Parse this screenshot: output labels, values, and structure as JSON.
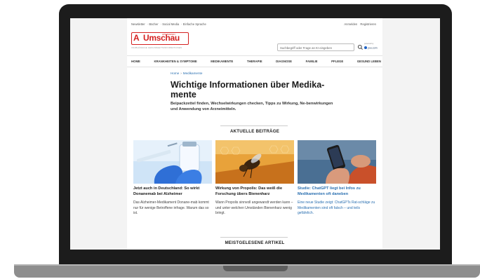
{
  "utility_left": [
    "Newsletter",
    "Bücher",
    "Social Media",
    "Einfache Sprache"
  ],
  "utility_right": [
    "Anmelden",
    "Registrieren"
  ],
  "logo": {
    "mark": "A",
    "word": "Umschau",
    "small": "APOTHEKEN",
    "tagline": "UNABHÄNGIGE GESUNDHEITSINFORMATIONEN"
  },
  "search": {
    "placeholder": "Suchbegriff oder Frage an KI eingeben",
    "powered_by": "powered by",
    "powered_brand": "you.com"
  },
  "nav": [
    "HOME",
    "KRANKHEITEN & SYMPTOME",
    "MEDIKAMENTE",
    "THERAPIE",
    "DIAGNOSE",
    "FAMILIE",
    "PFLEGE",
    "GESUND LEBEN"
  ],
  "breadcrumb": [
    "Home",
    "Medikamente"
  ],
  "page_title": "Wichtige Informationen über Medika-mente",
  "page_intro": "Beipackzettel finden, Wechselwirkungen checken, Tipps zu Wirkung, Ne-benwirkungen und Anwendung von Arzneimitteln.",
  "section_current": "AKTUELLE BEITRÄGE",
  "articles": [
    {
      "title": "Jetzt auch in Deutschland: So wirkt Donanemab bei Alzheimer",
      "teaser": "Das Alzheimer-Medikament Donane-mab kommt nur für wenige Betroffene infrage. Warum das so ist."
    },
    {
      "title": "Wirkung von Propolis: Das weiß die Forschung übers Bienenharz",
      "teaser": "Wann Propolis sinnvoll angewandt werden kann – und unter welchen Umständen Bienenharz wenig bringt."
    },
    {
      "title": "Studie: ChatGPT liegt bei Infos zu Medikamenten oft daneben",
      "teaser": "Eine neue Studie zeigt: ChatGPTs Rat-schläge zu Medikamenten sind oft falsch – und teils gefährlich."
    }
  ],
  "section_most_read": "MEISTGELESENE ARTIKEL",
  "colors": {
    "brand_red": "#d42020",
    "link_blue": "#2a6fb0"
  }
}
